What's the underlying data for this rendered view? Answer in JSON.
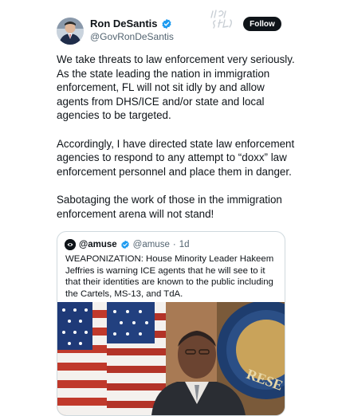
{
  "author": {
    "name": "Ron DeSantis",
    "handle": "@GovRonDeSantis",
    "verified": true
  },
  "follow_label": "Follow",
  "watermark_icon": "watermark-logo-icon",
  "tweet_paragraphs": [
    "We take threats to law enforcement very seriously. As the state leading the nation in immigration enforcement, FL will not sit idly by and allow agents from DHS/ICE and/or state and local agencies to be targeted.",
    "Accordingly, I have directed state law enforcement agencies to respond to any attempt to “doxx” law enforcement personnel and place them in danger.",
    "Sabotaging the work of those in the immigration enforcement arena will not stand!"
  ],
  "quote": {
    "name": "@amuse",
    "handle": "@amuse",
    "separator": "·",
    "time": "1d",
    "text": "WEAPONIZATION: House Minority Leader Hakeem Jeffries is warning ICE agents that he will see to it that their identities are known to the public including the Cartels, MS-13, and TdA."
  },
  "colors": {
    "text": "#0f1419",
    "secondary": "#536471",
    "verified_blue": "#1d9bf0",
    "border": "#cfd9de"
  }
}
